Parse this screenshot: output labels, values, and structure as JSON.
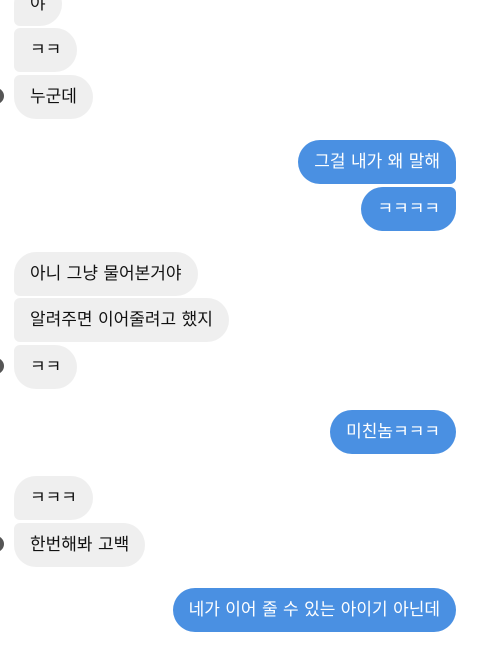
{
  "conversation": {
    "messages": [
      {
        "id": "m1",
        "side": "received",
        "text": "야"
      },
      {
        "id": "m2",
        "side": "received",
        "text": "ㅋㅋ"
      },
      {
        "id": "m3",
        "side": "received",
        "text": "누군데"
      },
      {
        "id": "m4",
        "side": "sent",
        "text": "그걸 내가 왜 말해"
      },
      {
        "id": "m5",
        "side": "sent",
        "text": "ㅋㅋㅋㅋ"
      },
      {
        "id": "m6",
        "side": "received",
        "text": "아니 그냥 물어본거야"
      },
      {
        "id": "m7",
        "side": "received",
        "text": "알려주면 이어줄려고 했지"
      },
      {
        "id": "m8",
        "side": "received",
        "text": "ㅋㅋ"
      },
      {
        "id": "m9",
        "side": "sent",
        "text": "미친놈ㅋㅋㅋ"
      },
      {
        "id": "m10",
        "side": "received",
        "text": "ㅋㅋㅋ"
      },
      {
        "id": "m11",
        "side": "received",
        "text": "한번해봐 고백"
      },
      {
        "id": "m12",
        "side": "sent",
        "text": "네가 이어 줄 수 있는 아이기 아닌데"
      }
    ]
  },
  "colors": {
    "sent_bubble": "#4a90e2",
    "received_bubble": "#efefef",
    "background": "#ffffff"
  }
}
